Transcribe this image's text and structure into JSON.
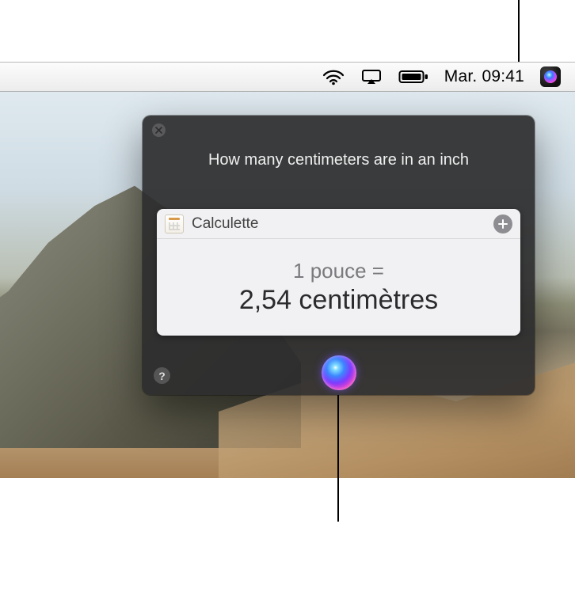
{
  "menubar": {
    "clock": "Mar. 09:41"
  },
  "siri": {
    "query": "How many centimeters are in an inch",
    "card": {
      "app": "Calculette",
      "unit_line": "1 pouce =",
      "value_line": "2,54 centimètres"
    },
    "help_glyph": "?"
  }
}
